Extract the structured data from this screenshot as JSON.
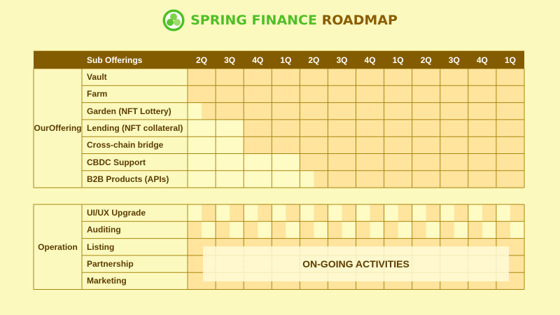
{
  "title": {
    "part1": "SPRING FINANCE",
    "part2": "ROADMAP"
  },
  "colors": {
    "header_bg": "#845c00",
    "filled": "#ffe49e",
    "empty": "#fffbc4",
    "border": "#a7860f",
    "green": "#4fbf27",
    "brown": "#8a5e00"
  },
  "header": {
    "sub_offerings": "Sub Offerings",
    "quarters": [
      "2Q",
      "3Q",
      "4Q",
      "1Q",
      "2Q",
      "3Q",
      "4Q",
      "1Q",
      "2Q",
      "3Q",
      "4Q",
      "1Q"
    ]
  },
  "sections": [
    {
      "name": "Our Offering",
      "name_lines": [
        "Our",
        "Offering"
      ],
      "rows": [
        {
          "label": "Vault",
          "start": 0
        },
        {
          "label": "Farm",
          "start": 0
        },
        {
          "label": "Garden (NFT Lottery)",
          "start": 0.5
        },
        {
          "label": "Lending (NFT collateral)",
          "start": 2
        },
        {
          "label": "Cross-chain bridge",
          "start": 2
        },
        {
          "label": "CBDC Support",
          "start": 4
        },
        {
          "label": "B2B Products (APIs)",
          "start": 4.5
        }
      ]
    },
    {
      "name": "Operation",
      "name_lines": [
        "Operation"
      ],
      "rows": [
        {
          "label": "UI/UX Upgrade",
          "pattern": "stripes"
        },
        {
          "label": "Auditing",
          "pattern": "stripes"
        },
        {
          "label": "Listing",
          "pattern": "solid"
        },
        {
          "label": "Partnership",
          "pattern": "solid"
        },
        {
          "label": "Marketing",
          "pattern": "solid"
        }
      ]
    }
  ],
  "ongoing_label": "ON-GOING ACTIVITIES"
}
